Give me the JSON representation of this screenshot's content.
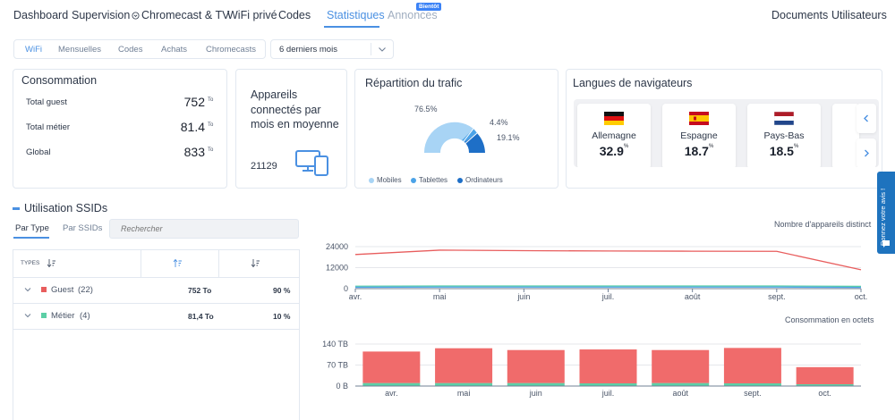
{
  "nav": {
    "items": [
      "Dashboard",
      "Supervision",
      "Chromecast & TV",
      "WiFi privé",
      "Codes",
      "Statistiques",
      "Annonces"
    ],
    "soon_badge": "Bientôt",
    "right": [
      "Documents",
      "Utilisateurs"
    ],
    "active_color": "#4a90e2"
  },
  "filters": {
    "tabs": [
      "WiFi",
      "Mensuelles",
      "Codes",
      "Achats",
      "Chromecasts"
    ],
    "period": "6 derniers mois"
  },
  "consommation": {
    "title": "Consommation",
    "rows": [
      {
        "label": "Total guest",
        "value": "752",
        "unit": "To"
      },
      {
        "label": "Total métier",
        "value": "81.4",
        "unit": "To"
      },
      {
        "label": "Global",
        "value": "833",
        "unit": "To"
      }
    ]
  },
  "appareils": {
    "title": "Appareils connectés par mois en moyenne",
    "value": "21129",
    "icon": "devices-icon"
  },
  "repartition": {
    "title": "Répartition du trafic",
    "labels": [
      "76.5%",
      "4.4%",
      "19.1%"
    ],
    "legend": [
      "Mobiles",
      "Tablettes",
      "Ordinateurs"
    ],
    "colors": [
      "#a8d4f5",
      "#4ba3e8",
      "#1e6fc7"
    ]
  },
  "langues": {
    "title": "Langues de navigateurs",
    "items": [
      {
        "name": "Allemagne",
        "value": "32.9",
        "unit": "%"
      },
      {
        "name": "Espagne",
        "value": "18.7",
        "unit": "%"
      },
      {
        "name": "Pays-Bas",
        "value": "18.5",
        "unit": "%"
      }
    ]
  },
  "ssid": {
    "title": "Utilisation SSIDs",
    "tabs": [
      "Par Type",
      "Par SSIDs"
    ],
    "search_placeholder": "Rechercher",
    "header_types": "TYPES",
    "rows": [
      {
        "name": "Guest",
        "count": "(22)",
        "value": "752 To",
        "pct": "90 %",
        "color": "#e85d5d"
      },
      {
        "name": "Métier",
        "count": "(4)",
        "value": "81,4 To",
        "pct": "10 %",
        "color": "#5ccfa6"
      }
    ]
  },
  "chart_data": [
    {
      "type": "line",
      "title": "Nombre d'appareils distinct",
      "categories": [
        "avr.",
        "mai",
        "juin",
        "juil.",
        "août",
        "sept.",
        "oct."
      ],
      "yticks": [
        "0",
        "12000",
        "24000"
      ],
      "ylim": [
        0,
        24000
      ],
      "series": [
        {
          "values": [
            19500,
            22000,
            21700,
            21500,
            21400,
            21300,
            10800
          ],
          "color": "#e85d5d"
        },
        {
          "values": [
            1400,
            1500,
            1500,
            1500,
            1500,
            1500,
            1300
          ],
          "color": "#5ccfa6"
        },
        {
          "values": [
            800,
            900,
            900,
            900,
            900,
            900,
            700
          ],
          "color": "#4ba3e8"
        }
      ]
    },
    {
      "type": "bar",
      "title": "Consommation en octets",
      "categories": [
        "avr.",
        "mai",
        "juin",
        "juil.",
        "août",
        "sept.",
        "oct."
      ],
      "yticks": [
        "0 B",
        "70 TB",
        "140 TB"
      ],
      "ylim": [
        0,
        140
      ],
      "series": [
        {
          "values": [
            105,
            116,
            110,
            113,
            110,
            118,
            57
          ],
          "color": "#f06b6b"
        },
        {
          "values": [
            10,
            10,
            10,
            9,
            10,
            9,
            6
          ],
          "color": "#5ccfa6"
        }
      ]
    }
  ],
  "feedback": {
    "label": "Donnez votre avis !"
  }
}
